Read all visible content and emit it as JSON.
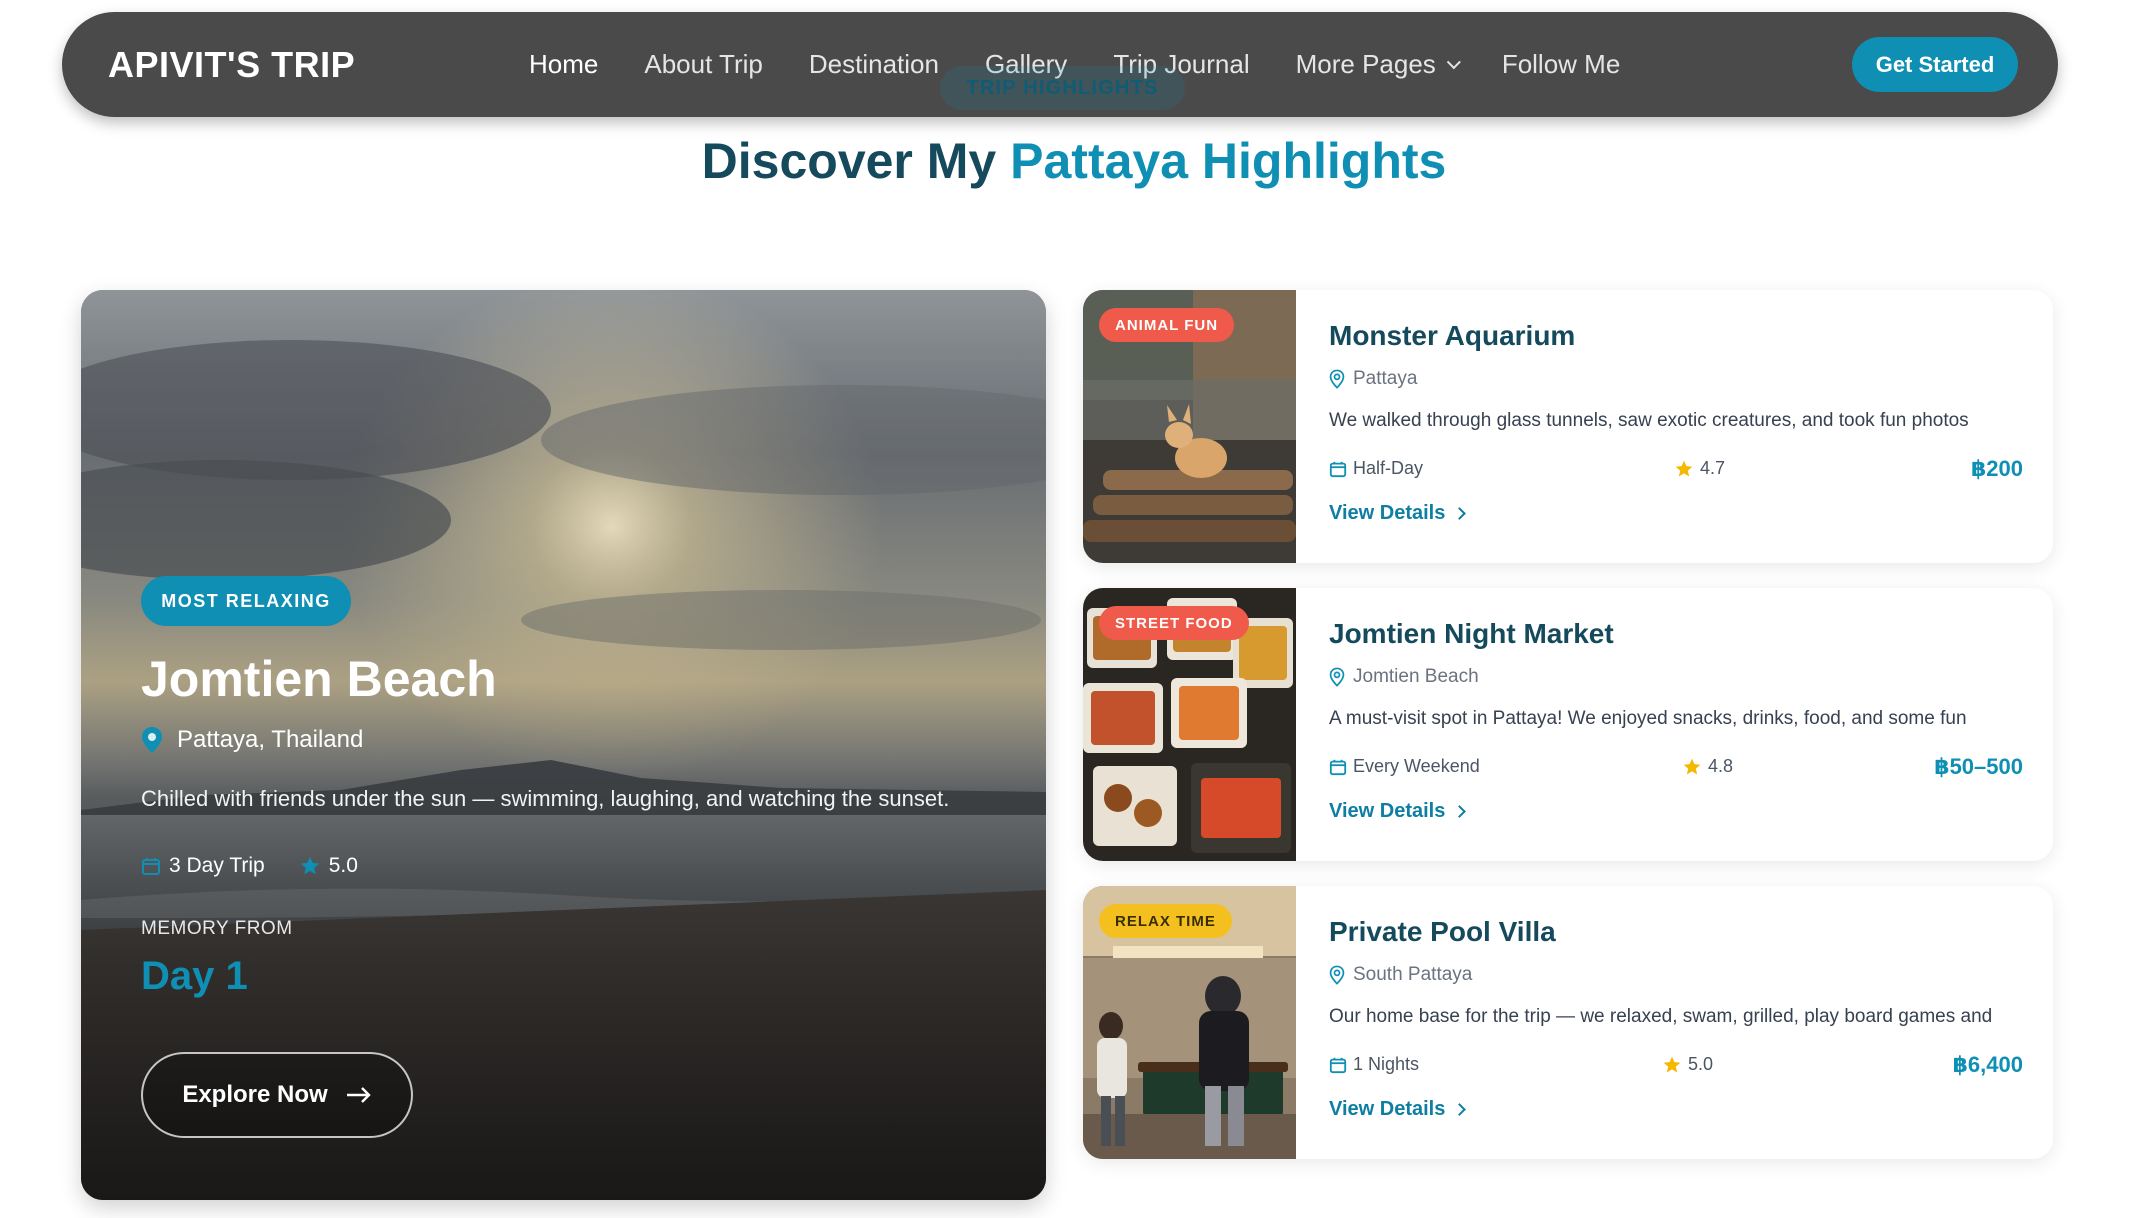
{
  "nav": {
    "brand": "APIVIT'S TRIP",
    "items": [
      {
        "label": "Home",
        "active": true
      },
      {
        "label": "About Trip"
      },
      {
        "label": "Destination"
      },
      {
        "label": "Gallery"
      },
      {
        "label": "Trip Journal"
      },
      {
        "label": "More Pages",
        "has_dropdown": true
      },
      {
        "label": "Follow Me"
      }
    ],
    "cta": "Get Started"
  },
  "section": {
    "label": "TRIP HIGHLIGHTS",
    "title_part1": "Discover My ",
    "title_part2": "Pattaya Highlights"
  },
  "hero": {
    "badge": "MOST RELAXING",
    "title": "Jomtien Beach",
    "location": "Pattaya, Thailand",
    "description": "Chilled with friends under the sun — swimming, laughing, and watching the sunset.",
    "duration": "3 Day Trip",
    "rating": "5.0",
    "memory_label": "MEMORY FROM",
    "day": "Day 1",
    "button": "Explore Now"
  },
  "cards": [
    {
      "tag": "ANIMAL FUN",
      "tag_color": "#f05a4a",
      "title": "Monster Aquarium",
      "location": "Pattaya",
      "description": "We walked through glass tunnels, saw exotic creatures, and took fun photos",
      "duration": "Half-Day",
      "rating": "4.7",
      "price": "฿200",
      "link": "View Details"
    },
    {
      "tag": "STREET FOOD",
      "tag_color": "#f05a4a",
      "title": "Jomtien Night Market",
      "location": "Jomtien Beach",
      "description": "A must-visit spot in Pattaya! We enjoyed snacks, drinks, food, and some fun",
      "duration": "Every Weekend",
      "rating": "4.8",
      "price": "฿50–500",
      "link": "View Details"
    },
    {
      "tag": "RELAX TIME",
      "tag_color": "#f4c020",
      "title": "Private Pool Villa",
      "location": "South Pattaya",
      "description": "Our home base for the trip — we relaxed, swam, grilled, play board games and",
      "duration": "1 Nights",
      "rating": "5.0",
      "price": "฿6,400",
      "link": "View Details"
    }
  ],
  "colors": {
    "accent": "#0e8fb3",
    "heading": "#15495c",
    "nav_bg": "#4a4a4a",
    "star": "#f5b800"
  }
}
